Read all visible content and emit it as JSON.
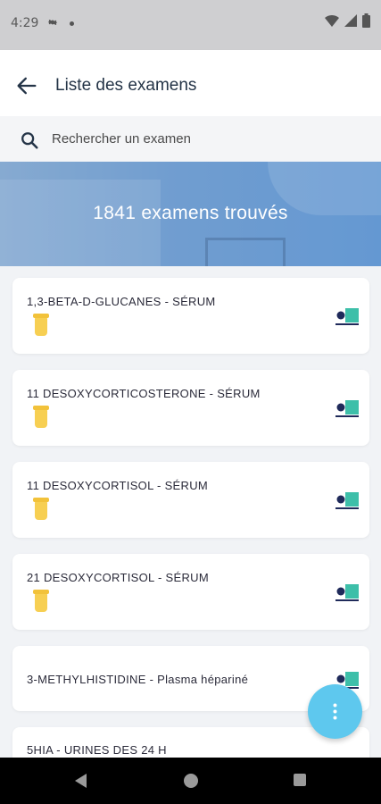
{
  "status_bar": {
    "time": "4:29",
    "icons": [
      "gear-icon",
      "dot-icon",
      "wifi-icon",
      "signal-icon",
      "battery-icon"
    ]
  },
  "header": {
    "title": "Liste des examens",
    "back_icon": "arrow-back-icon"
  },
  "search": {
    "placeholder": "Rechercher un examen",
    "icon": "search-icon"
  },
  "banner": {
    "text": "1841 examens trouvés"
  },
  "exams": [
    {
      "label": "1,3-BETA-D-GLUCANES - SÉRUM",
      "has_tube": true
    },
    {
      "label": "11 DESOXYCORTICOSTERONE - SÉRUM",
      "has_tube": true
    },
    {
      "label": "11 DESOXYCORTISOL - SÉRUM",
      "has_tube": true
    },
    {
      "label": "21 DESOXYCORTISOL - SÉRUM",
      "has_tube": true
    },
    {
      "label": "3-METHYLHISTIDINE - Plasma hépariné",
      "has_tube": false
    },
    {
      "label": "5HIA - URINES DES 24 H",
      "has_tube": false
    }
  ],
  "colors": {
    "accent": "#5ec8ee",
    "title_text": "#243447",
    "tube": "#f7cf52",
    "badge_dark": "#1f2a5a",
    "badge_teal": "#3dbfa9"
  },
  "fab": {
    "icon": "more-vertical-icon"
  },
  "nav": {
    "icons": [
      "nav-back-icon",
      "nav-home-icon",
      "nav-recent-icon"
    ]
  }
}
